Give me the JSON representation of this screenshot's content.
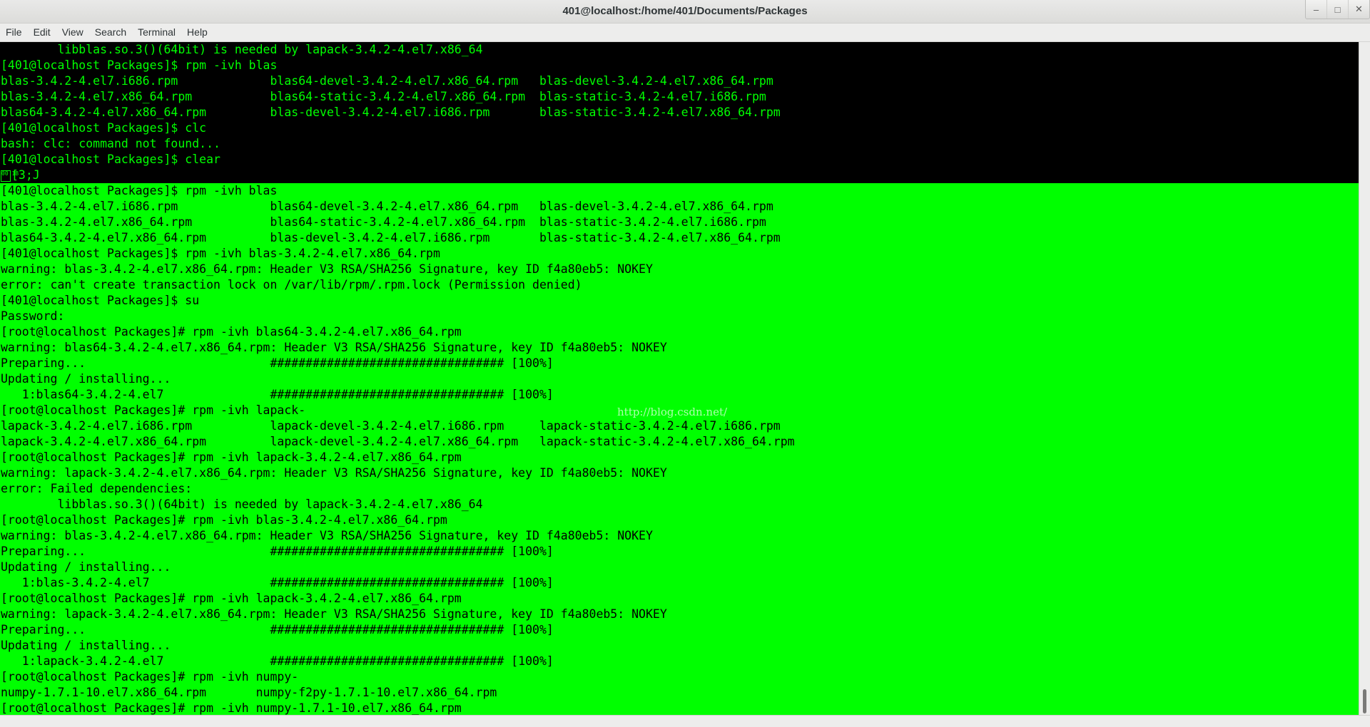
{
  "window": {
    "title": "401@localhost:/home/401/Documents/Packages",
    "buttons": {
      "minimize": "–",
      "maximize": "□",
      "close": "✕"
    }
  },
  "menu": [
    "File",
    "Edit",
    "View",
    "Search",
    "Terminal",
    "Help"
  ],
  "terminal": {
    "cursor_glyph": "00 1B",
    "lines": [
      "        libblas.so.3()(64bit) is needed by lapack-3.4.2-4.el7.x86_64",
      "[401@localhost Packages]$ rpm -ivh blas",
      "blas-3.4.2-4.el7.i686.rpm             blas64-devel-3.4.2-4.el7.x86_64.rpm   blas-devel-3.4.2-4.el7.x86_64.rpm",
      "blas-3.4.2-4.el7.x86_64.rpm           blas64-static-3.4.2-4.el7.x86_64.rpm  blas-static-3.4.2-4.el7.i686.rpm",
      "blas64-3.4.2-4.el7.x86_64.rpm         blas-devel-3.4.2-4.el7.i686.rpm       blas-static-3.4.2-4.el7.x86_64.rpm",
      "[401@localhost Packages]$ clc",
      "bash: clc: command not found...",
      "[401@localhost Packages]$ clear",
      "[3;J",
      "[401@localhost Packages]$ rpm -ivh blas",
      "blas-3.4.2-4.el7.i686.rpm             blas64-devel-3.4.2-4.el7.x86_64.rpm   blas-devel-3.4.2-4.el7.x86_64.rpm",
      "blas-3.4.2-4.el7.x86_64.rpm           blas64-static-3.4.2-4.el7.x86_64.rpm  blas-static-3.4.2-4.el7.i686.rpm",
      "blas64-3.4.2-4.el7.x86_64.rpm         blas-devel-3.4.2-4.el7.i686.rpm       blas-static-3.4.2-4.el7.x86_64.rpm",
      "[401@localhost Packages]$ rpm -ivh blas-3.4.2-4.el7.x86_64.rpm",
      "warning: blas-3.4.2-4.el7.x86_64.rpm: Header V3 RSA/SHA256 Signature, key ID f4a80eb5: NOKEY",
      "error: can't create transaction lock on /var/lib/rpm/.rpm.lock (Permission denied)",
      "[401@localhost Packages]$ su",
      "Password:",
      "[root@localhost Packages]# rpm -ivh blas64-3.4.2-4.el7.x86_64.rpm",
      "warning: blas64-3.4.2-4.el7.x86_64.rpm: Header V3 RSA/SHA256 Signature, key ID f4a80eb5: NOKEY",
      "Preparing...                          ################################# [100%]",
      "Updating / installing...",
      "   1:blas64-3.4.2-4.el7               ################################# [100%]",
      "[root@localhost Packages]# rpm -ivh lapack-",
      "lapack-3.4.2-4.el7.i686.rpm           lapack-devel-3.4.2-4.el7.i686.rpm     lapack-static-3.4.2-4.el7.i686.rpm",
      "lapack-3.4.2-4.el7.x86_64.rpm         lapack-devel-3.4.2-4.el7.x86_64.rpm   lapack-static-3.4.2-4.el7.x86_64.rpm",
      "[root@localhost Packages]# rpm -ivh lapack-3.4.2-4.el7.x86_64.rpm",
      "warning: lapack-3.4.2-4.el7.x86_64.rpm: Header V3 RSA/SHA256 Signature, key ID f4a80eb5: NOKEY",
      "error: Failed dependencies:",
      "        libblas.so.3()(64bit) is needed by lapack-3.4.2-4.el7.x86_64",
      "[root@localhost Packages]# rpm -ivh blas-3.4.2-4.el7.x86_64.rpm",
      "warning: blas-3.4.2-4.el7.x86_64.rpm: Header V3 RSA/SHA256 Signature, key ID f4a80eb5: NOKEY",
      "Preparing...                          ################################# [100%]",
      "Updating / installing...",
      "   1:blas-3.4.2-4.el7                 ################################# [100%]",
      "[root@localhost Packages]# rpm -ivh lapack-3.4.2-4.el7.x86_64.rpm",
      "warning: lapack-3.4.2-4.el7.x86_64.rpm: Header V3 RSA/SHA256 Signature, key ID f4a80eb5: NOKEY",
      "Preparing...                          ################################# [100%]",
      "Updating / installing...",
      "   1:lapack-3.4.2-4.el7               ################################# [100%]",
      "[root@localhost Packages]# rpm -ivh numpy-",
      "numpy-1.7.1-10.el7.x86_64.rpm       numpy-f2py-1.7.1-10.el7.x86_64.rpm",
      "[root@localhost Packages]# rpm -ivh numpy-1.7.1-10.el7.x86_64.rpm"
    ]
  },
  "watermark": "http://blog.csdn.net/",
  "colors": {
    "terminal_bg": "#000000",
    "terminal_fg": "#00ff00",
    "highlight_bg": "#00ff00",
    "highlight_fg": "#000000"
  }
}
